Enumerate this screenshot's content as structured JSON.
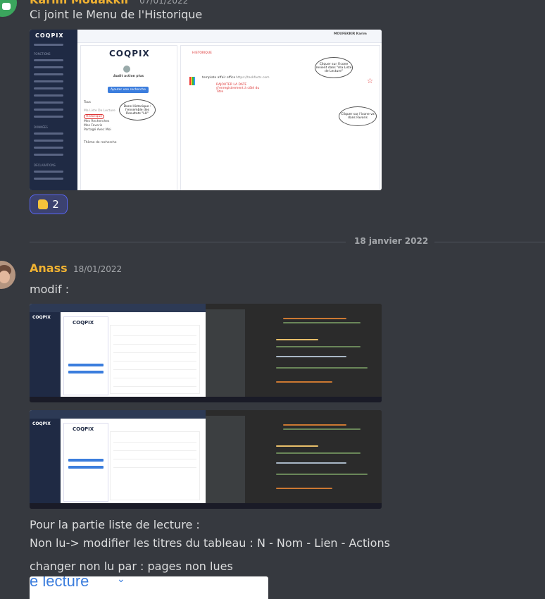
{
  "message1": {
    "author": "Karim Mouakkir",
    "timestamp": "07/01/2022",
    "text": "Ci joint le Menu de l'Historique",
    "screenshot": {
      "logo": "COQPIX",
      "card_title": "Audit action plus",
      "button": "Ajouter une recherche",
      "tous": "Tous",
      "list_items": [
        "Ma Liste De Lecture",
        "Historique",
        "Mes Recherches",
        "Mes Favoris",
        "Partagé Avec Moi"
      ],
      "theme": "Thème de recherche",
      "bubble_left": "Dans Historique : l'ensemble des Resultats \"LU\"",
      "bubble_top_right": "Cliquer sur l'icone revient dans \"ma Liste de Lecture\"",
      "bubble_bottom_right": "Cliquer sur l'icone va dans Favoris",
      "history_label": "HISTORIQUE",
      "entry_title": "template affair office",
      "entry_url": "https://taskfacts.com",
      "entry_note": "RAJOUTER LA DATE d'enregistrement à côté du Titre",
      "user": "MOUFEKKIR Karim"
    },
    "reaction": {
      "emoji": "thumbs-up",
      "count": "2"
    }
  },
  "divider": {
    "date": "18 janvier 2022"
  },
  "message2": {
    "author": "Anass",
    "timestamp": "18/01/2022",
    "text": "modif :",
    "shots": [
      {
        "logo": "COQPIX"
      },
      {
        "logo": "COQPIX"
      }
    ],
    "lines": [
      "Pour la partie liste de lecture :",
      "Non lu-> modifier les titres du tableau :  N - Nom - Lien - Actions",
      "changer non lu par : pages non lues"
    ],
    "cut_image_text": "e lecture"
  },
  "colors": {
    "accent": "#5865f2",
    "author": "#f0b232",
    "background": "#36393f"
  }
}
